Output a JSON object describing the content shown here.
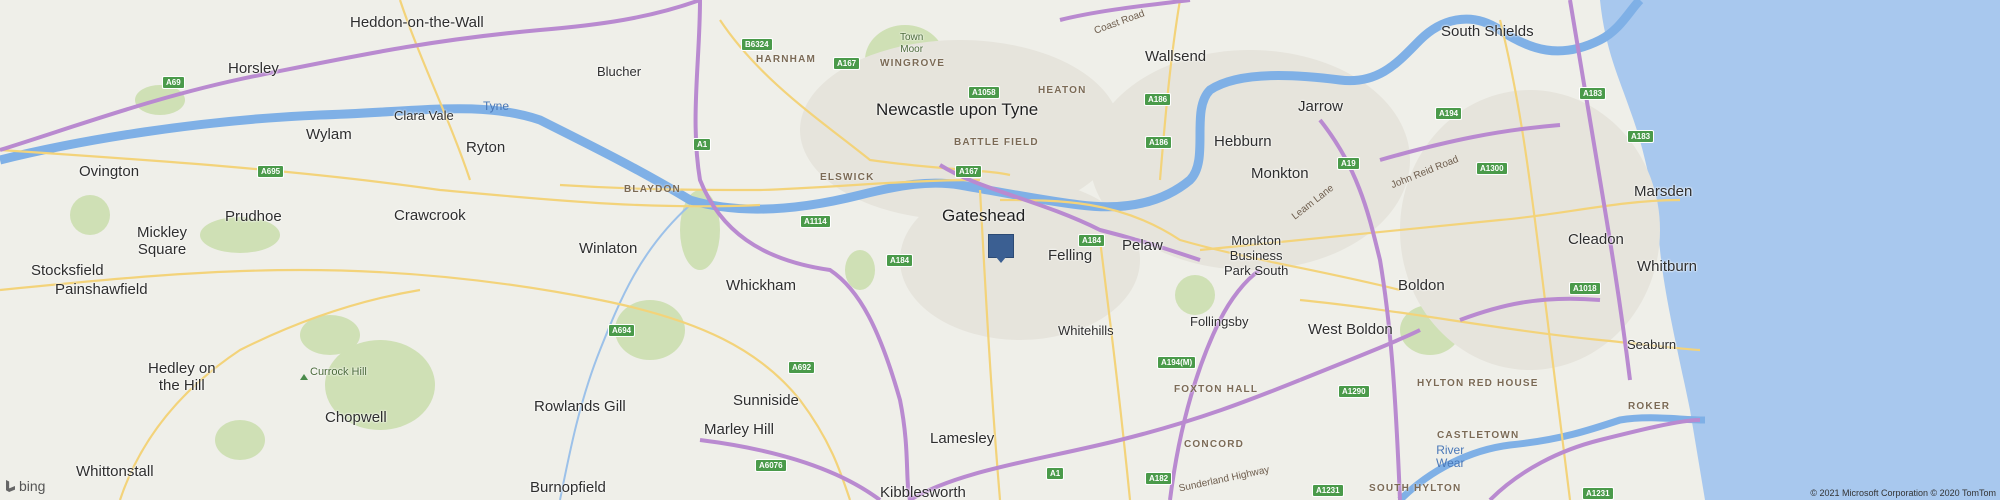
{
  "map": {
    "attribution": "© 2021 Microsoft Corporation © 2020 TomTom",
    "provider": "bing",
    "colors": {
      "land": "#efefe9",
      "sea": "#a8c8ee",
      "river": "#7fb0e6",
      "motorway": "#b98ad0",
      "road": "#f3d37a",
      "park": "#cbdcb0"
    },
    "places": [
      {
        "id": "heddon-on-the-wall",
        "label": "Heddon-on-the-Wall"
      },
      {
        "id": "horsley",
        "label": "Horsley"
      },
      {
        "id": "blucher",
        "label": "Blucher"
      },
      {
        "id": "town-moor",
        "label": "Town\nMoor"
      },
      {
        "id": "wallsend",
        "label": "Wallsend"
      },
      {
        "id": "south-shields",
        "label": "South Shields"
      },
      {
        "id": "clara-vale",
        "label": "Clara Vale"
      },
      {
        "id": "wylam",
        "label": "Wylam"
      },
      {
        "id": "newcastle-upon-tyne",
        "label": "Newcastle upon Tyne"
      },
      {
        "id": "jarrow",
        "label": "Jarrow"
      },
      {
        "id": "hebburn",
        "label": "Hebburn"
      },
      {
        "id": "ovington",
        "label": "Ovington"
      },
      {
        "id": "ryton",
        "label": "Ryton"
      },
      {
        "id": "monkton",
        "label": "Monkton"
      },
      {
        "id": "marsden",
        "label": "Marsden"
      },
      {
        "id": "prudhoe",
        "label": "Prudhoe"
      },
      {
        "id": "crawcrook",
        "label": "Crawcrook"
      },
      {
        "id": "gateshead",
        "label": "Gateshead"
      },
      {
        "id": "mickley-square",
        "label": "Mickley\nSquare"
      },
      {
        "id": "winlaton",
        "label": "Winlaton"
      },
      {
        "id": "felling",
        "label": "Felling"
      },
      {
        "id": "pelaw",
        "label": "Pelaw"
      },
      {
        "id": "monkton-business-park-south",
        "label": "Monkton\nBusiness\nPark South"
      },
      {
        "id": "cleadon",
        "label": "Cleadon"
      },
      {
        "id": "stocksfield",
        "label": "Stocksfield"
      },
      {
        "id": "whitburn",
        "label": "Whitburn"
      },
      {
        "id": "painshawfield",
        "label": "Painshawfield"
      },
      {
        "id": "whickham",
        "label": "Whickham"
      },
      {
        "id": "boldon",
        "label": "Boldon"
      },
      {
        "id": "follingsby",
        "label": "Follingsby"
      },
      {
        "id": "whitehills",
        "label": "Whitehills"
      },
      {
        "id": "west-boldon",
        "label": "West Boldon"
      },
      {
        "id": "seaburn",
        "label": "Seaburn"
      },
      {
        "id": "hedley-on-the-hill",
        "label": "Hedley on\nthe Hill"
      },
      {
        "id": "curroch-hill",
        "label": "Currock Hill"
      },
      {
        "id": "sunniside",
        "label": "Sunniside"
      },
      {
        "id": "chopwell",
        "label": "Chopwell"
      },
      {
        "id": "rowlands-gill",
        "label": "Rowlands Gill"
      },
      {
        "id": "marley-hill",
        "label": "Marley Hill"
      },
      {
        "id": "lamesley",
        "label": "Lamesley"
      },
      {
        "id": "whittonstall",
        "label": "Whittonstall"
      },
      {
        "id": "river-wear",
        "label": "River\nWear"
      },
      {
        "id": "burnopfield",
        "label": "Burnopfield"
      },
      {
        "id": "kibblesworth",
        "label": "Kibblesworth"
      }
    ],
    "districts": [
      {
        "id": "harnham",
        "label": "HARNHAM"
      },
      {
        "id": "wingrove",
        "label": "WINGROVE"
      },
      {
        "id": "heaton",
        "label": "HEATON"
      },
      {
        "id": "battle-field",
        "label": "BATTLE FIELD"
      },
      {
        "id": "elswick",
        "label": "ELSWICK"
      },
      {
        "id": "blaydon",
        "label": "BLAYDON"
      },
      {
        "id": "foxton-hall",
        "label": "FOXTON HALL"
      },
      {
        "id": "hylton-red-house",
        "label": "HYLTON RED HOUSE"
      },
      {
        "id": "roker",
        "label": "ROKER"
      },
      {
        "id": "concord",
        "label": "CONCORD"
      },
      {
        "id": "castletown",
        "label": "CASTLETOWN"
      },
      {
        "id": "south-hylton",
        "label": "SOUTH HYLTON"
      }
    ],
    "water_labels": [
      {
        "id": "tyne",
        "label": "Tyne"
      }
    ],
    "road_labels": [
      {
        "id": "coast-road",
        "label": "Coast Road"
      },
      {
        "id": "leam-lane",
        "label": "Leam Lane"
      },
      {
        "id": "john-reid-road",
        "label": "John Reid Road"
      },
      {
        "id": "sunderland-highway",
        "label": "Sunderland Highway"
      }
    ],
    "road_shields": [
      "A69",
      "B6324",
      "A167",
      "A1058",
      "A186",
      "A1",
      "A695",
      "A167",
      "A1114",
      "A184",
      "A184",
      "A694",
      "A692",
      "A6076",
      "A1",
      "A183",
      "A194",
      "A183",
      "A1300",
      "A1018",
      "A194(M)",
      "A1290",
      "A19",
      "A182",
      "A1231",
      "A1231",
      "A186"
    ]
  }
}
